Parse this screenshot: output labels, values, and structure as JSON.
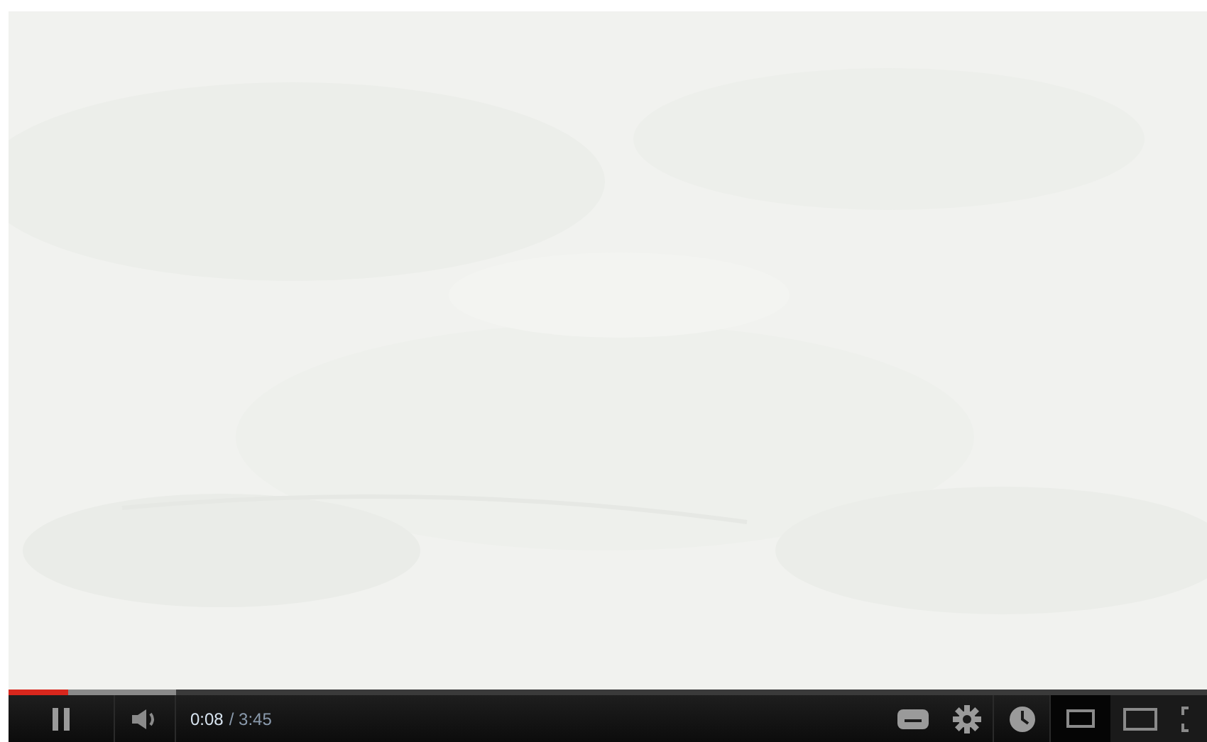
{
  "progress": {
    "level": 0.05,
    "buffered": {
      "level": 0.14
    }
  },
  "controls": {
    "current_time": "0:08",
    "duration": "/ 3:45"
  },
  "size_buttons": [
    {
      "kind": "small",
      "selected": true
    },
    {
      "kind": "large",
      "selected": false
    },
    {
      "kind": "fullscreen",
      "selected": false
    }
  ]
}
